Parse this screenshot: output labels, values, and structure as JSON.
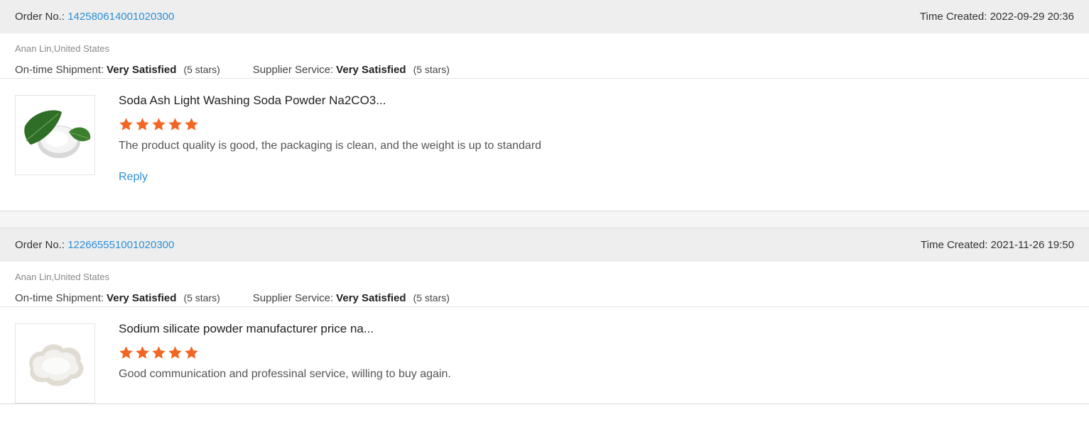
{
  "orders": [
    {
      "order_no_label": "Order No.:",
      "order_no": "142580614001020300",
      "time_label": "Time Created:",
      "time": "2022-09-29 20:36",
      "buyer": "Anan Lin,United States",
      "shipment_label": "On-time Shipment:",
      "shipment_value": "Very Satisfied",
      "shipment_stars": "(5 stars)",
      "service_label": "Supplier Service:",
      "service_value": "Very Satisfied",
      "service_stars": "(5 stars)",
      "product_title": "Soda Ash Light Washing Soda Powder Na2CO3...",
      "product_image": "soda-ash-powder-with-leaf",
      "rating": 5,
      "review": "The product quality is good, the packaging is clean, and the weight is up to standard",
      "reply_label": "Reply"
    },
    {
      "order_no_label": "Order No.:",
      "order_no": "122665551001020300",
      "time_label": "Time Created:",
      "time": "2021-11-26 19:50",
      "buyer": "Anan Lin,United States",
      "shipment_label": "On-time Shipment:",
      "shipment_value": "Very Satisfied",
      "shipment_stars": "(5 stars)",
      "service_label": "Supplier Service:",
      "service_value": "Very Satisfied",
      "service_stars": "(5 stars)",
      "product_title": "Sodium silicate powder manufacturer price na...",
      "product_image": "sodium-silicate-powder-in-dish",
      "rating": 5,
      "review": "Good communication and professinal service, willing to buy again."
    }
  ],
  "colors": {
    "accent": "#2d8fd5",
    "star": "#f26522",
    "header_bg": "#eeeeee"
  }
}
